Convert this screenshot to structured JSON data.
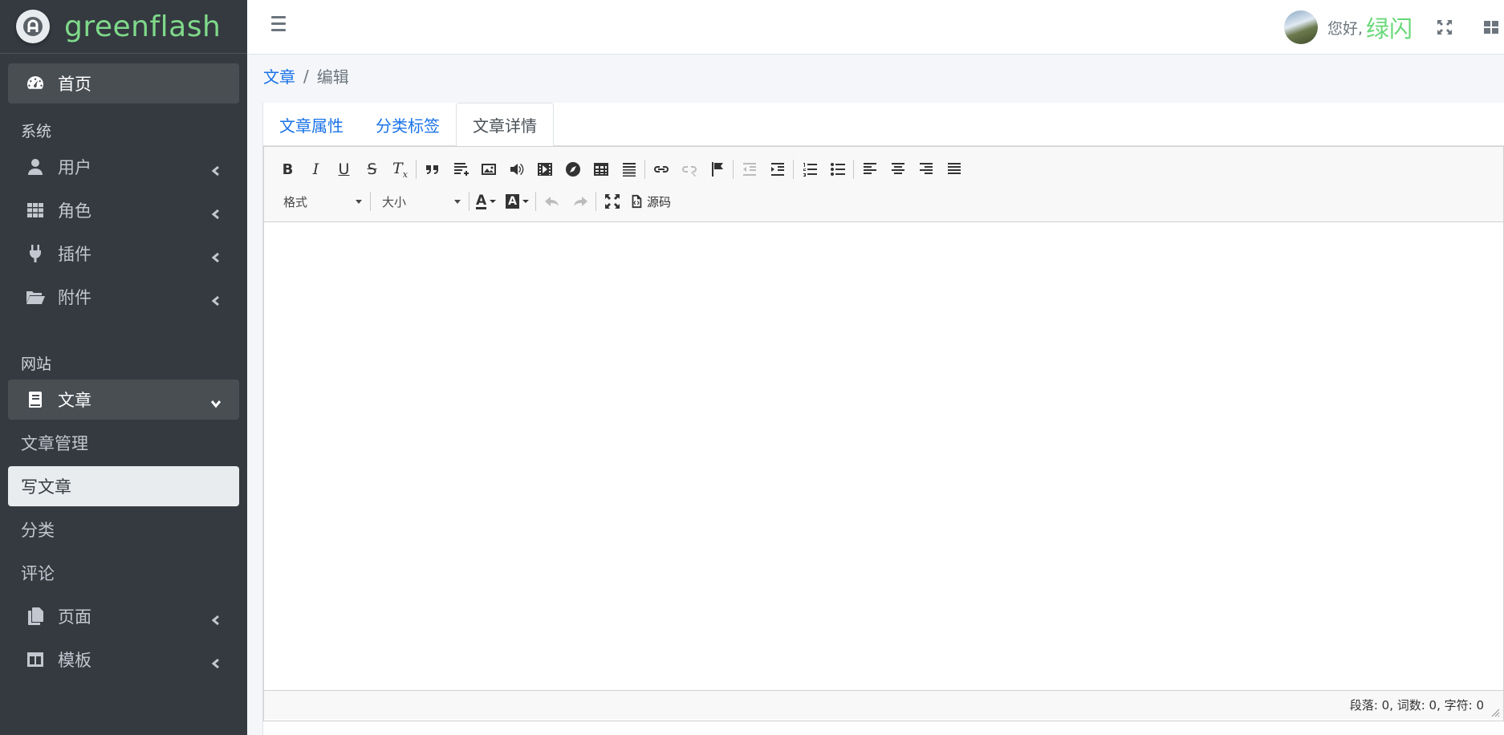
{
  "brand": {
    "name": "greenflash"
  },
  "sidebar": {
    "home": "首页",
    "section_system": "系统",
    "system_items": [
      {
        "label": "用户",
        "icon": "user-icon"
      },
      {
        "label": "角色",
        "icon": "grid-icon"
      },
      {
        "label": "插件",
        "icon": "plug-icon"
      },
      {
        "label": "附件",
        "icon": "folder-open-icon"
      }
    ],
    "section_site": "网站",
    "article": {
      "label": "文章",
      "icon": "book-icon"
    },
    "article_subitems": [
      "文章管理",
      "写文章",
      "分类",
      "评论"
    ],
    "site_items": [
      {
        "label": "页面",
        "icon": "copy-icon"
      },
      {
        "label": "模板",
        "icon": "columns-icon"
      }
    ]
  },
  "topbar": {
    "greeting": "您好,",
    "username": "绿闪"
  },
  "breadcrumb": {
    "parent": "文章",
    "separator": "/",
    "current": "编辑"
  },
  "tabs": [
    "文章属性",
    "分类标签",
    "文章详情"
  ],
  "editor": {
    "format_label": "格式",
    "size_label": "大小",
    "source_label": "源码",
    "status": "段落: 0, 词数: 0, 字符: 0"
  },
  "colors": {
    "sidebar_bg": "#343a40",
    "brand_text": "#7fd98a",
    "link": "#1a73e8",
    "username": "#6ad87a"
  }
}
